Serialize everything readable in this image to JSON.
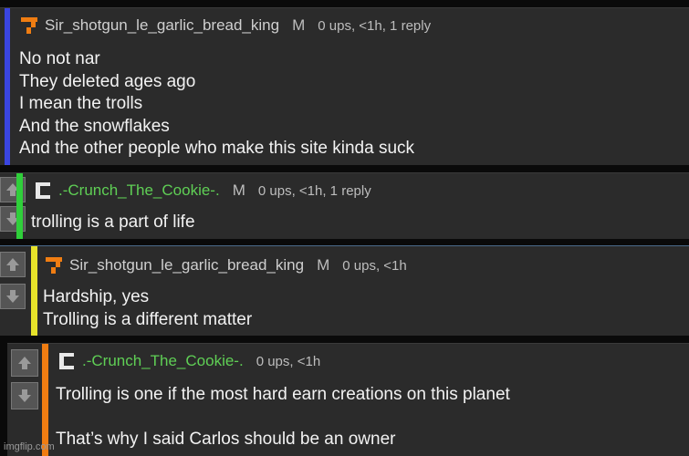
{
  "comments": [
    {
      "username": "Sir_shotgun_le_garlic_bread_king",
      "badge": "M",
      "stats": "0 ups, <1h, 1 reply",
      "bar_color": "#3a45e0",
      "name_color": "#cfcfcf",
      "avatar_icon": "orange-seven-avatar-icon",
      "lines": [
        "No not nar",
        "They deleted ages ago",
        "I mean the trolls",
        "And the snowflakes",
        "And the other people who make this site kinda suck"
      ]
    },
    {
      "username": ".-Crunch_The_Cookie-.",
      "badge": "M",
      "stats": "0 ups, <1h, 1 reply",
      "bar_color": "#2fcf3a",
      "name_color": "#5fcf55",
      "avatar_icon": "white-c-avatar-icon",
      "lines": [
        "trolling is a part of life"
      ]
    },
    {
      "username": "Sir_shotgun_le_garlic_bread_king",
      "badge": "M",
      "stats": "0 ups, <1h",
      "bar_color": "#e6e22a",
      "name_color": "#cfcfcf",
      "avatar_icon": "orange-seven-avatar-icon",
      "lines": [
        "Hardship, yes",
        "Trolling is a different matter"
      ]
    },
    {
      "username": ".-Crunch_The_Cookie-.",
      "badge": "",
      "stats": "0 ups, <1h",
      "bar_color": "#f07d12",
      "name_color": "#5fcf55",
      "avatar_icon": "white-c-avatar-icon",
      "lines": [
        "Trolling is one if the most hard earn creations on this planet",
        "",
        "That’s why I said Carlos should be an owner"
      ]
    }
  ],
  "watermark": "imgflip.com"
}
